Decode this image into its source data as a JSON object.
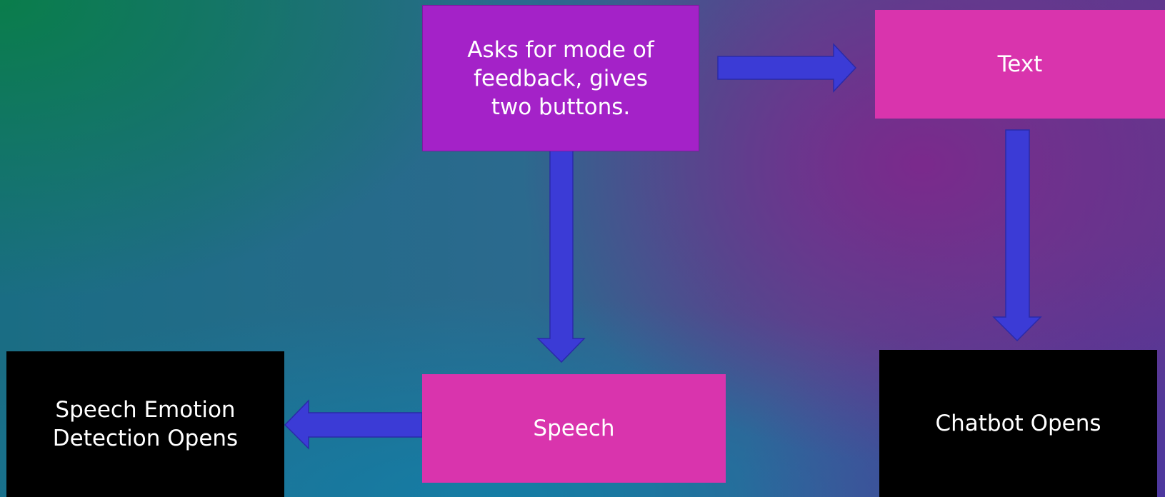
{
  "nodes": {
    "start": {
      "label": "Asks for mode of feedback, gives two buttons."
    },
    "text_option": {
      "label": "Text"
    },
    "speech_option": {
      "label": "Speech"
    },
    "speech_result": {
      "label": "Speech Emotion Detection Opens"
    },
    "text_result": {
      "label": "Chatbot Opens"
    }
  },
  "edges": [
    {
      "from": "start",
      "to": "text_option"
    },
    {
      "from": "start",
      "to": "speech_option"
    },
    {
      "from": "speech_option",
      "to": "speech_result"
    },
    {
      "from": "text_option",
      "to": "text_result"
    }
  ],
  "colors": {
    "decision_box": "#a422c8",
    "option_box": "#d934ad",
    "result_box": "#000000",
    "arrow_fill": "#3b3bd6",
    "arrow_stroke": "#2a2aa8"
  }
}
